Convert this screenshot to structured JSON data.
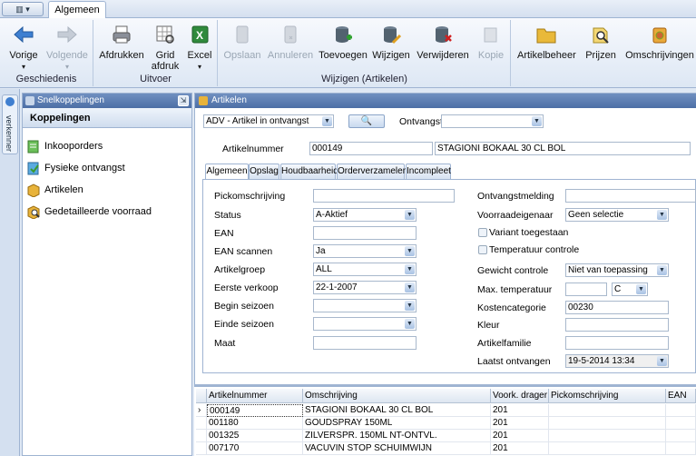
{
  "ribbon": {
    "tab": "Algemeen",
    "groups": {
      "geschiedenis": "Geschiedenis",
      "uitvoer": "Uitvoer",
      "wijzigen": "Wijzigen (Artikelen)"
    },
    "buttons": {
      "vorige": "Vorige",
      "volgende": "Volgende",
      "afdrukken": "Afdrukken",
      "grid_line1": "Grid",
      "grid_line2": "afdruk",
      "excel": "Excel",
      "opslaan": "Opslaan",
      "annuleren": "Annuleren",
      "toevoegen": "Toevoegen",
      "wijzigen": "Wijzigen",
      "verwijderen": "Verwijderen",
      "kopie": "Kopie",
      "artikelbeheer": "Artikelbeheer",
      "prijzen": "Prijzen",
      "omschrijvingen": "Omschrijvingen"
    }
  },
  "left": {
    "vertical_tab": "verkenner",
    "panel_title": "Snelkoppelingen",
    "section": "Koppelingen",
    "items": [
      "Inkooporders",
      "Fysieke ontvangst",
      "Artikelen",
      "Gedetailleerde voorraad"
    ]
  },
  "main": {
    "panel_title": "Artikelen",
    "filter_select": "ADV - Artikel in ontvangst",
    "ontvangst_label": "Ontvangst",
    "ontvangst_value": "",
    "artikelnummer_label": "Artikelnummer",
    "artikelnummer": "000149",
    "omschrijving": "STAGIONI BOKAAL 30 CL BOL",
    "tabs": [
      "Algemeen",
      "Opslag",
      "Houdbaarheid",
      "Orderverzamelen",
      "Incompleet"
    ],
    "form": {
      "pickomschrijving": {
        "label": "Pickomschrijving",
        "value": ""
      },
      "status": {
        "label": "Status",
        "value": "A-Aktief"
      },
      "ean": {
        "label": "EAN",
        "value": ""
      },
      "ean_scannen": {
        "label": "EAN scannen",
        "value": "Ja"
      },
      "artikelgroep": {
        "label": "Artikelgroep",
        "value": "ALL"
      },
      "eerste_verkoop": {
        "label": "Eerste verkoop",
        "value": "22-1-2007"
      },
      "begin_seizoen": {
        "label": "Begin seizoen",
        "value": ""
      },
      "einde_seizoen": {
        "label": "Einde seizoen",
        "value": ""
      },
      "maat": {
        "label": "Maat",
        "value": ""
      },
      "ontvangstmelding": {
        "label": "Ontvangstmelding",
        "value": ""
      },
      "voorraadeigenaar": {
        "label": "Voorraadeigenaar",
        "value": "Geen selectie"
      },
      "variant_toegestaan": "Variant toegestaan",
      "temperatuur_controle": "Temperatuur controle",
      "gewicht_controle": {
        "label": "Gewicht controle",
        "value": "Niet van toepassing"
      },
      "max_temperatuur": {
        "label": "Max. temperatuur",
        "value": "",
        "unit": "C"
      },
      "kostencategorie": {
        "label": "Kostencategorie",
        "value": "00230"
      },
      "kleur": {
        "label": "Kleur",
        "value": ""
      },
      "artikelfamilie": {
        "label": "Artikelfamilie",
        "value": ""
      },
      "laatst_ontvangen": {
        "label": "Laatst ontvangen",
        "value": "19-5-2014 13:34"
      }
    }
  },
  "grid": {
    "columns": [
      "Artikelnummer",
      "Omschrijving",
      "Voork. drager",
      "Pickomschrijving",
      "EAN"
    ],
    "rows": [
      [
        "000149",
        "STAGIONI BOKAAL 30 CL BOL",
        "201"
      ],
      [
        "001180",
        "GOUDSPRAY 150ML",
        "201"
      ],
      [
        "001325",
        "ZILVERSPR. 150ML NT-ONTVL.",
        "201"
      ],
      [
        "007170",
        "VACUVIN STOP SCHUIMWIJN",
        "201"
      ]
    ]
  }
}
